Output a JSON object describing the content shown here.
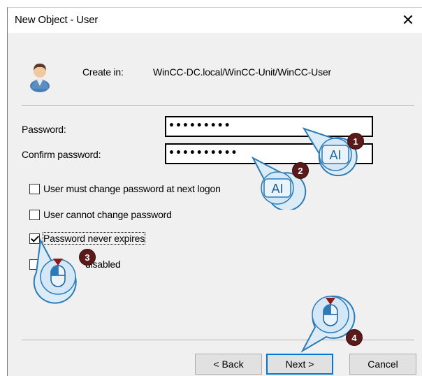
{
  "window": {
    "title": "New Object - User",
    "close_glyph": "✕"
  },
  "header": {
    "create_label": "Create in:",
    "create_path": "WinCC-DC.local/WinCC-Unit/WinCC-User"
  },
  "fields": {
    "password_label": "Password:",
    "password_value": "•••••••••",
    "confirm_label": "Confirm password:",
    "confirm_value": "••••••••••"
  },
  "options": [
    {
      "label": "User must change password at next logon",
      "checked": false
    },
    {
      "label": "User cannot change password",
      "checked": false
    },
    {
      "label": "Password never expires",
      "checked": true
    },
    {
      "label": "Account is disabled",
      "checked": false,
      "visible_label": "disabled"
    }
  ],
  "buttons": {
    "back": "< Back",
    "next": "Next >",
    "cancel": "Cancel"
  },
  "annotations": {
    "badges": [
      "1",
      "2",
      "3",
      "4"
    ],
    "text_cursor_glyph": "AI",
    "colors": {
      "bubble_fill": "#dcecf7",
      "bubble_stroke": "#2c7bb6",
      "badge_fill": "#5a1a1a"
    }
  }
}
